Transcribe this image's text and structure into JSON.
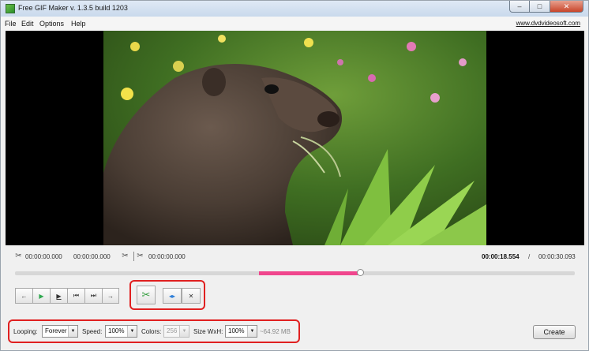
{
  "window": {
    "title": "Free GIF Maker v. 1.3.5 build 1203",
    "controls": {
      "minimize": "–",
      "maximize": "□",
      "close": "✕"
    }
  },
  "menu": {
    "items": [
      "File",
      "Edit",
      "Options",
      "Help"
    ],
    "site_link": "www.dvdvideosoft.com"
  },
  "times": {
    "start": "00:00:00.000",
    "selection_length": "00:00:00.000",
    "end": "00:00:00.000",
    "current": "00:00:18.554",
    "separator": "/",
    "total": "00:00:30.093"
  },
  "timeline": {
    "selection_start_fraction": 0.436,
    "selection_end_fraction": 0.616,
    "handle_fraction": 0.616,
    "selection_color": "#f0468d"
  },
  "playback_buttons": [
    {
      "name": "step-back-button",
      "glyph": "←"
    },
    {
      "name": "play-button",
      "glyph": "▶"
    },
    {
      "name": "play-selection-button",
      "glyph": "▶"
    },
    {
      "name": "go-start-button",
      "glyph": "⏮"
    },
    {
      "name": "go-end-button",
      "glyph": "⏭"
    },
    {
      "name": "step-forward-button",
      "glyph": "→"
    }
  ],
  "edit_buttons": {
    "cut_icon": "scissors-icon",
    "split_glyph": "◂▸",
    "delete_glyph": "✕"
  },
  "settings": {
    "looping_label": "Looping:",
    "looping_value": "Forever",
    "speed_label": "Speed:",
    "speed_value": "100%",
    "colors_label": "Colors:",
    "colors_value": "256",
    "size_label": "Size WxH:",
    "size_value": "100%",
    "size_estimate": "~64.92 MB"
  },
  "create_button": "Create",
  "colors": {
    "highlight_red": "#e02020",
    "accent_green": "#2f9c3a"
  }
}
